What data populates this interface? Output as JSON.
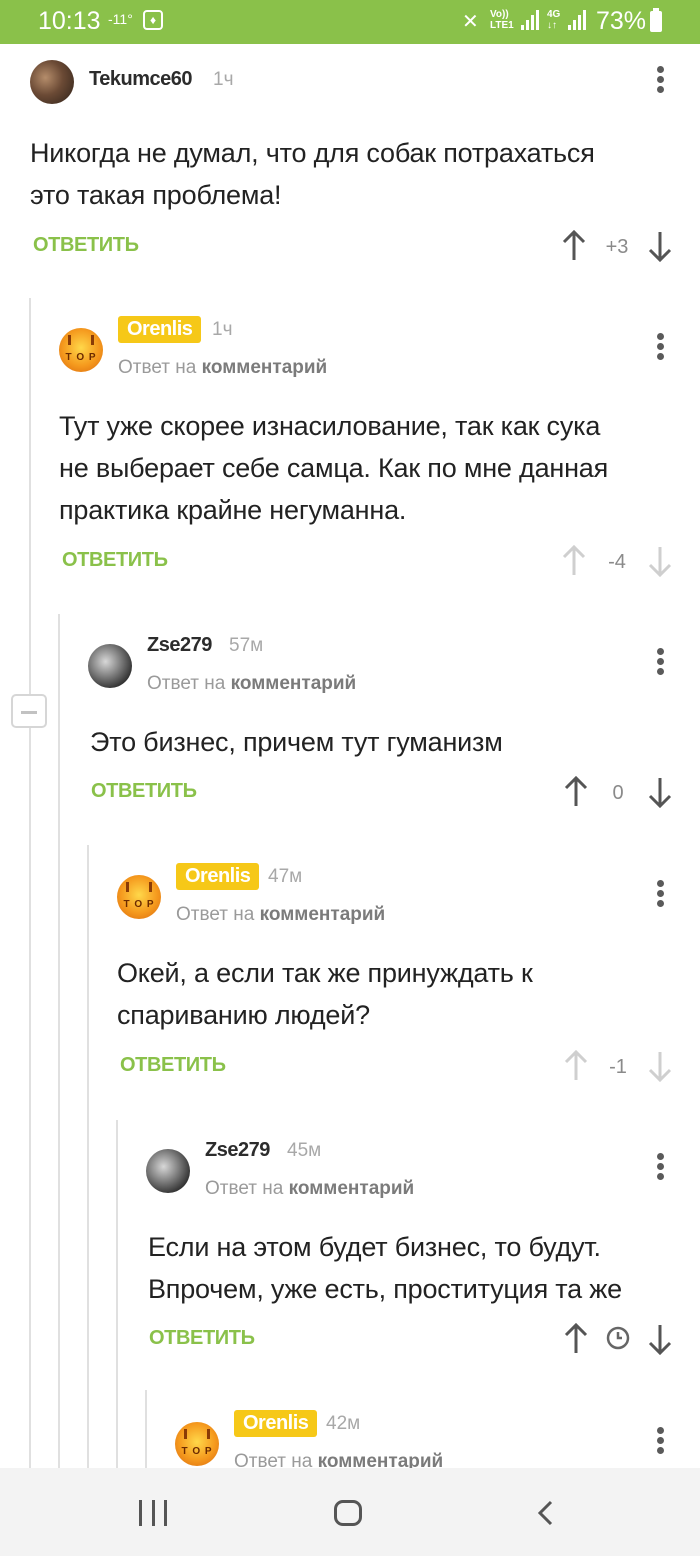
{
  "status_bar": {
    "time": "10:13",
    "temperature": "-11°",
    "network1": [
      "Vo))",
      "LTE1"
    ],
    "network2": [
      "4G",
      "↓↑"
    ],
    "battery": "73%",
    "bg_color": "#8ac14a"
  },
  "reply_label": "ОТВЕТИТЬ",
  "reply_to_prefix": "Ответ на",
  "reply_to_link": "комментарий",
  "comments": [
    {
      "author": "Tekumce60",
      "time": "1ч",
      "text_lines": [
        "Никогда не думал, что для собак потрахаться",
        "это такая проблема!"
      ],
      "score": "+3"
    },
    {
      "author": "Orenlis",
      "time": "1ч",
      "text_lines": [
        "Тут уже скорее изнасилование, так как сука",
        "не выберает себе самца. Как по мне данная",
        "практика крайне негуманна."
      ],
      "score": "-4"
    },
    {
      "author": "Zse279",
      "time": "57м",
      "text_lines": [
        "Это бизнес, причем тут гуманизм"
      ],
      "score": "0"
    },
    {
      "author": "Orenlis",
      "time": "47м",
      "text_lines": [
        "Окей, а если так же принуждать к",
        "спариванию людей?"
      ],
      "score": "-1"
    },
    {
      "author": "Zse279",
      "time": "45м",
      "text_lines": [
        "Если на этом будет бизнес, то будут.",
        "Впрочем, уже есть, проституция та же"
      ],
      "score": ""
    },
    {
      "author": "Orenlis",
      "time": "42м",
      "text_lines": [],
      "score": ""
    }
  ],
  "avatar_text": "T O P",
  "colors": {
    "accent": "#8ac14a",
    "badge": "#f6c818"
  },
  "icons": [
    "more-vert-icon",
    "arrow-up-icon",
    "arrow-down-icon",
    "clock-icon",
    "recent-apps-icon",
    "home-icon",
    "back-icon"
  ]
}
